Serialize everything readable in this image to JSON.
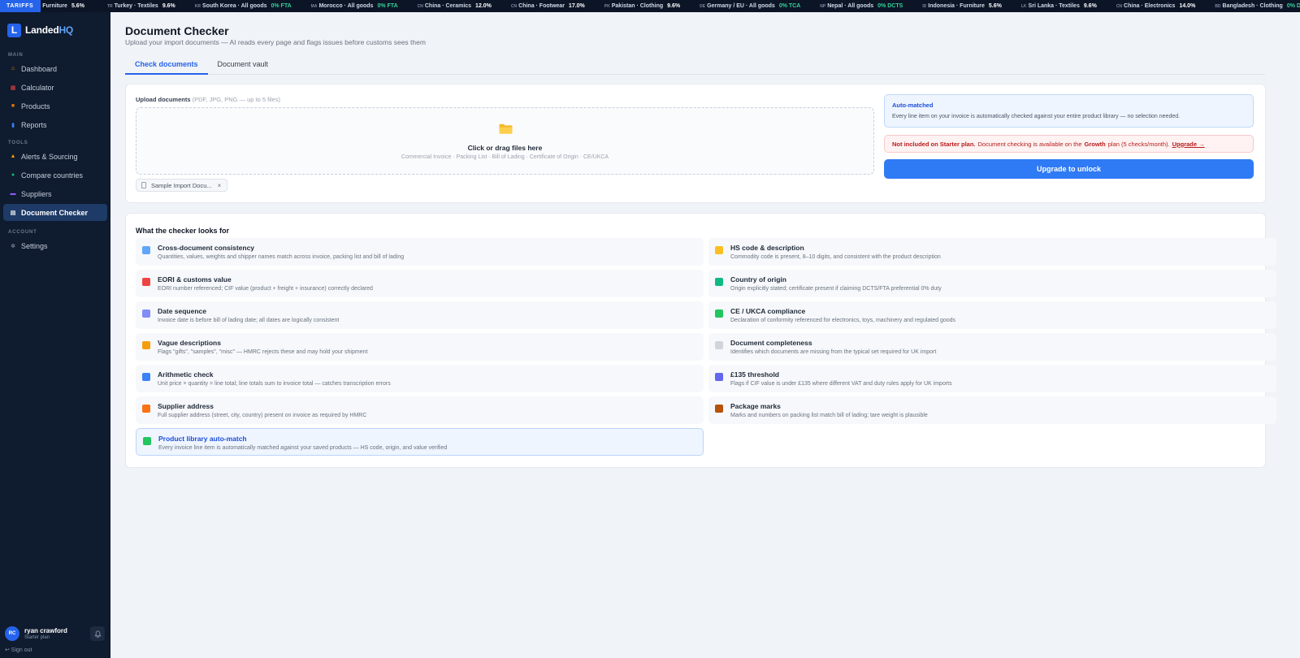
{
  "ticker": {
    "label": "TARIFFS",
    "first": {
      "name": "Furniture",
      "value": "5.6%"
    },
    "items": [
      {
        "code": "TR",
        "name": "Turkey · Textiles",
        "value": "9.6%",
        "green": false
      },
      {
        "code": "KR",
        "name": "South Korea · All goods",
        "value": "0% FTA",
        "green": true
      },
      {
        "code": "MA",
        "name": "Morocco · All goods",
        "value": "0% FTA",
        "green": true
      },
      {
        "code": "CN",
        "name": "China · Ceramics",
        "value": "12.0%",
        "green": false
      },
      {
        "code": "CN",
        "name": "China · Footwear",
        "value": "17.0%",
        "green": false
      },
      {
        "code": "PK",
        "name": "Pakistan · Clothing",
        "value": "9.6%",
        "green": false
      },
      {
        "code": "DE",
        "name": "Germany / EU · All goods",
        "value": "0% TCA",
        "green": true
      },
      {
        "code": "NP",
        "name": "Nepal · All goods",
        "value": "0% DCTS",
        "green": true
      },
      {
        "code": "ID",
        "name": "Indonesia · Furniture",
        "value": "5.6%",
        "green": false
      },
      {
        "code": "LK",
        "name": "Sri Lanka · Textiles",
        "value": "9.6%",
        "green": false
      },
      {
        "code": "CN",
        "name": "China · Electronics",
        "value": "14.0%",
        "green": false
      },
      {
        "code": "BD",
        "name": "Bangladesh · Clothing",
        "value": "0% DCTS",
        "green": true
      }
    ]
  },
  "brand": {
    "logo_letter": "L",
    "name_main": "Landed",
    "name_accent": "HQ"
  },
  "sidebar": {
    "section_main": "MAIN",
    "section_tools": "TOOLS",
    "section_account": "ACCOUNT",
    "main_items": [
      {
        "label": "Dashboard",
        "icon": "home-icon",
        "color": "#f59e0b",
        "glyph": "⌂"
      },
      {
        "label": "Calculator",
        "icon": "calculator-icon",
        "color": "#ef4444",
        "glyph": "▦"
      },
      {
        "label": "Products",
        "icon": "box-icon",
        "color": "#d97706",
        "glyph": "■"
      },
      {
        "label": "Reports",
        "icon": "bar-chart-icon",
        "color": "#3b82f6",
        "glyph": "▮"
      }
    ],
    "tools_items": [
      {
        "label": "Alerts & Sourcing",
        "icon": "bell-icon",
        "color": "#f59e0b",
        "glyph": "▲"
      },
      {
        "label": "Compare countries",
        "icon": "globe-icon",
        "color": "#10b981",
        "glyph": "●"
      },
      {
        "label": "Suppliers",
        "icon": "factory-icon",
        "color": "#8b5cf6",
        "glyph": "▬"
      },
      {
        "label": "Document Checker",
        "icon": "clipboard-icon",
        "color": "#e5e7eb",
        "glyph": "▤",
        "active": true
      }
    ],
    "account_items": [
      {
        "label": "Settings",
        "icon": "gear-icon",
        "color": "#9ca3af",
        "glyph": "✲"
      }
    ],
    "user": {
      "initials": "RC",
      "name": "ryan crawford",
      "plan": "Starter plan"
    },
    "sign_out": "↩ Sign out"
  },
  "page": {
    "title": "Document Checker",
    "subtitle": "Upload your import documents — AI reads every page and flags issues before customs sees them",
    "tabs": [
      {
        "label": "Check documents",
        "active": true
      },
      {
        "label": "Document vault",
        "active": false
      }
    ]
  },
  "upload": {
    "label": "Upload documents",
    "hint": "(PDF, JPG, PNG — up to 5 files)",
    "drop_title": "Click or drag files here",
    "drop_types": "Commercial Invoice · Packing List · Bill of Lading · Certificate of Origin · CE/UKCA",
    "file_chip": "Sample Import Docu...",
    "remove": "×"
  },
  "automatch": {
    "title": "Auto-matched",
    "text": "Every line item on your invoice is automatically checked against your entire product library — no selection needed."
  },
  "notice": {
    "bold": "Not included on Starter plan.",
    "text_before": "Document checking is available on the",
    "plan": "Growth",
    "text_after": "plan (5 checks/month).",
    "link": "Upgrade →"
  },
  "upgrade_button": "Upgrade to unlock",
  "checks": {
    "title": "What the checker looks for",
    "left": [
      {
        "title": "Cross-document consistency",
        "desc": "Quantities, values, weights and shipper names match across invoice, packing list and bill of lading",
        "icon": "chart-icon",
        "color": "#60a5fa"
      },
      {
        "title": "EORI & customs value",
        "desc": "EORI number referenced; CIF value (product + freight + insurance) correctly declared",
        "icon": "pin-icon",
        "color": "#ef4444"
      },
      {
        "title": "Date sequence",
        "desc": "Invoice date is before bill of lading date; all dates are logically consistent",
        "icon": "calendar-icon",
        "color": "#818cf8"
      },
      {
        "title": "Vague descriptions",
        "desc": "Flags \"gifts\", \"samples\", \"misc\" — HMRC rejects these and may hold your shipment",
        "icon": "warning-icon",
        "color": "#f59e0b"
      },
      {
        "title": "Arithmetic check",
        "desc": "Unit price × quantity = line total; line totals sum to invoice total — catches transcription errors",
        "icon": "numbers-icon",
        "color": "#3b82f6"
      },
      {
        "title": "Supplier address",
        "desc": "Full supplier address (street, city, country) present on invoice as required by HMRC",
        "icon": "house-icon",
        "color": "#f97316"
      },
      {
        "title": "Product library auto-match",
        "desc": "Every invoice line item is automatically matched against your saved products — HS code, origin, and value verified",
        "icon": "books-icon",
        "color": "#22c55e",
        "highlight": true
      }
    ],
    "right": [
      {
        "title": "HS code & description",
        "desc": "Commodity code is present, 8–10 digits, and consistent with the product description",
        "icon": "tag-icon",
        "color": "#fbbf24"
      },
      {
        "title": "Country of origin",
        "desc": "Origin explicitly stated; certificate present if claiming DCTS/FTA preferential 0% duty",
        "icon": "globe-icon",
        "color": "#10b981"
      },
      {
        "title": "CE / UKCA compliance",
        "desc": "Declaration of conformity referenced for electronics, toys, machinery and regulated goods",
        "icon": "checkbox-icon",
        "color": "#22c55e"
      },
      {
        "title": "Document completeness",
        "desc": "Identifies which documents are missing from the typical set required for UK import",
        "icon": "clipboard-icon",
        "color": "#d1d5db"
      },
      {
        "title": "£135 threshold",
        "desc": "Flags if CIF value is under £135 where different VAT and duty rules apply for UK imports",
        "icon": "flag-icon",
        "color": "#6366f1"
      },
      {
        "title": "Package marks",
        "desc": "Marks and numbers on packing list match bill of lading; tare weight is plausible",
        "icon": "package-icon",
        "color": "#b45309"
      }
    ]
  }
}
